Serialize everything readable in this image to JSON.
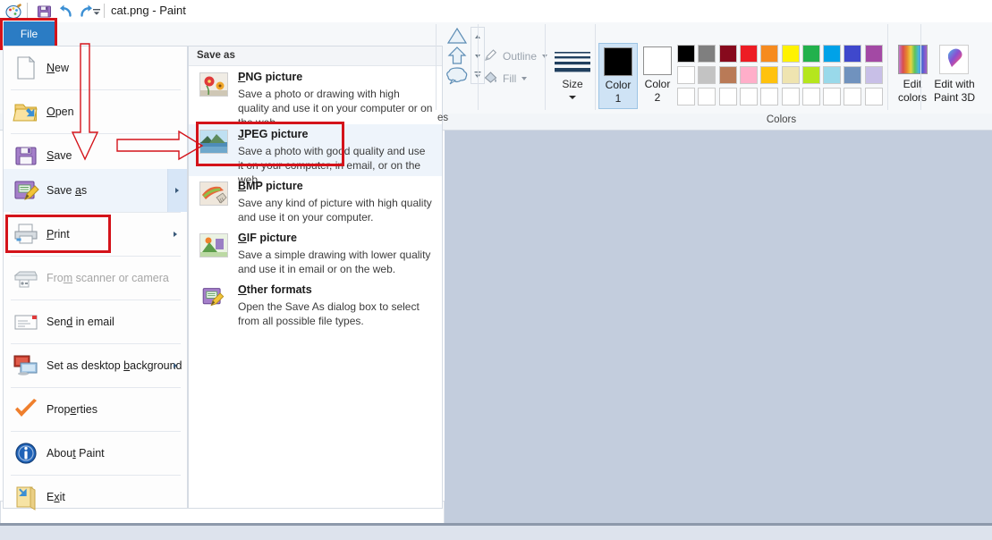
{
  "window": {
    "title": "cat.png - Paint"
  },
  "quick_access": [
    {
      "name": "paint-app-icon",
      "label": "Paint"
    },
    {
      "name": "save-icon",
      "label": "Save"
    },
    {
      "name": "undo-icon",
      "label": "Undo"
    },
    {
      "name": "redo-icon",
      "label": "Redo"
    },
    {
      "name": "customize-quick-access-icon",
      "label": "Customize Quick Access Toolbar"
    }
  ],
  "file_tab": {
    "label": "File",
    "highlight_color": "#d4131a",
    "active_color": "#2b7cc4"
  },
  "file_menu": {
    "items": [
      {
        "label": "New",
        "accel": "N",
        "icon": "new-document-icon",
        "submenu": false,
        "disabled": false
      },
      {
        "label": "Open",
        "accel": "O",
        "icon": "open-folder-icon",
        "submenu": false,
        "disabled": false
      },
      {
        "label": "Save",
        "accel": "S",
        "icon": "floppy-disk-icon",
        "submenu": false,
        "disabled": false
      },
      {
        "label": "Save as",
        "accel": "a",
        "icon": "save-as-icon",
        "submenu": true,
        "disabled": false,
        "selected": true
      },
      {
        "label": "Print",
        "accel": "P",
        "icon": "printer-icon",
        "submenu": true,
        "disabled": false
      },
      {
        "label": "From scanner or camera",
        "accel": "m",
        "icon": "scanner-icon",
        "submenu": false,
        "disabled": true
      },
      {
        "label": "Send in email",
        "accel": "d",
        "icon": "email-icon",
        "submenu": false,
        "disabled": false
      },
      {
        "label": "Set as desktop background",
        "accel": "b",
        "icon": "desktop-icon",
        "submenu": true,
        "disabled": false
      },
      {
        "label": "Properties",
        "accel": "e",
        "icon": "checkmark-icon",
        "submenu": false,
        "disabled": false
      },
      {
        "label": "About Paint",
        "accel": "t",
        "icon": "info-icon",
        "submenu": false,
        "disabled": false
      },
      {
        "label": "Exit",
        "accel": "x",
        "icon": "exit-icon",
        "submenu": false,
        "disabled": false
      }
    ]
  },
  "save_as_panel": {
    "header": "Save as",
    "formats": [
      {
        "title": "PNG picture",
        "accel": "P",
        "icon": "png-flowers-icon",
        "description": "Save a photo or drawing with high quality and use it on your computer or on the web."
      },
      {
        "title": "JPEG picture",
        "accel": "J",
        "icon": "jpeg-landscape-icon",
        "selected": true,
        "description": "Save a photo with good quality and use it on your computer, in email, or on the web."
      },
      {
        "title": "BMP picture",
        "accel": "B",
        "icon": "bmp-brush-icon",
        "description": "Save any kind of picture with high quality and use it on your computer."
      },
      {
        "title": "GIF picture",
        "accel": "G",
        "icon": "gif-scene-icon",
        "description": "Save a simple drawing with lower quality and use it in email or on the web."
      },
      {
        "title": "Other formats",
        "accel": "O",
        "icon": "save-as-icon",
        "description": "Open the Save As dialog box to select from all possible file types."
      }
    ]
  },
  "annotations": {
    "arrow_down": {
      "name": "red-down-arrow",
      "color": "#d4131a"
    },
    "arrow_right": {
      "name": "red-right-arrow",
      "color": "#d4131a"
    },
    "file_tab_box": {
      "name": "red-highlight-box-file",
      "color": "#d4131a"
    },
    "save_as_box": {
      "name": "red-highlight-box-save-as",
      "color": "#d4131a"
    },
    "jpeg_box": {
      "name": "red-highlight-box-jpeg",
      "color": "#d4131a"
    }
  },
  "ribbon": {
    "shapes_group_label": "es",
    "shapes": [
      "triangle-shape",
      "arrow-up-shape",
      "callout-shape"
    ],
    "outline": {
      "label": "Outline",
      "icon": "pencil-outline-icon"
    },
    "fill": {
      "label": "Fill",
      "icon": "paint-bucket-icon"
    },
    "size": {
      "label": "Size",
      "icon": "line-thickness-icon"
    },
    "color1": {
      "line1": "Color",
      "line2": "1",
      "value": "#000000"
    },
    "color2": {
      "line1": "Color",
      "line2": "2",
      "value": "#ffffff"
    },
    "colors_label": "Colors",
    "edit_colors": {
      "line1": "Edit",
      "line2": "colors",
      "icon": "rainbow-palette-icon"
    },
    "paint3d": {
      "line1": "Edit with",
      "line2": "Paint 3D",
      "icon": "paint3d-droplet-icon"
    },
    "palette": {
      "row1": [
        "#000000",
        "#7f7f7f",
        "#870a1d",
        "#ed1c24",
        "#f68b1f",
        "#fff200",
        "#22b14c",
        "#00a2e8",
        "#3f48cc",
        "#a349a4"
      ],
      "row2": [
        "#ffffff",
        "#c3c3c3",
        "#b97a57",
        "#ffaec9",
        "#ffc20e",
        "#efe4b0",
        "#b5e61d",
        "#99d9ea",
        "#7092be",
        "#c8bfe7"
      ],
      "row3": [
        "#ffffff",
        "#ffffff",
        "#ffffff",
        "#ffffff",
        "#ffffff",
        "#ffffff",
        "#ffffff",
        "#ffffff",
        "#ffffff",
        "#ffffff"
      ]
    }
  },
  "canvas": {
    "background": "#c3cddd"
  }
}
